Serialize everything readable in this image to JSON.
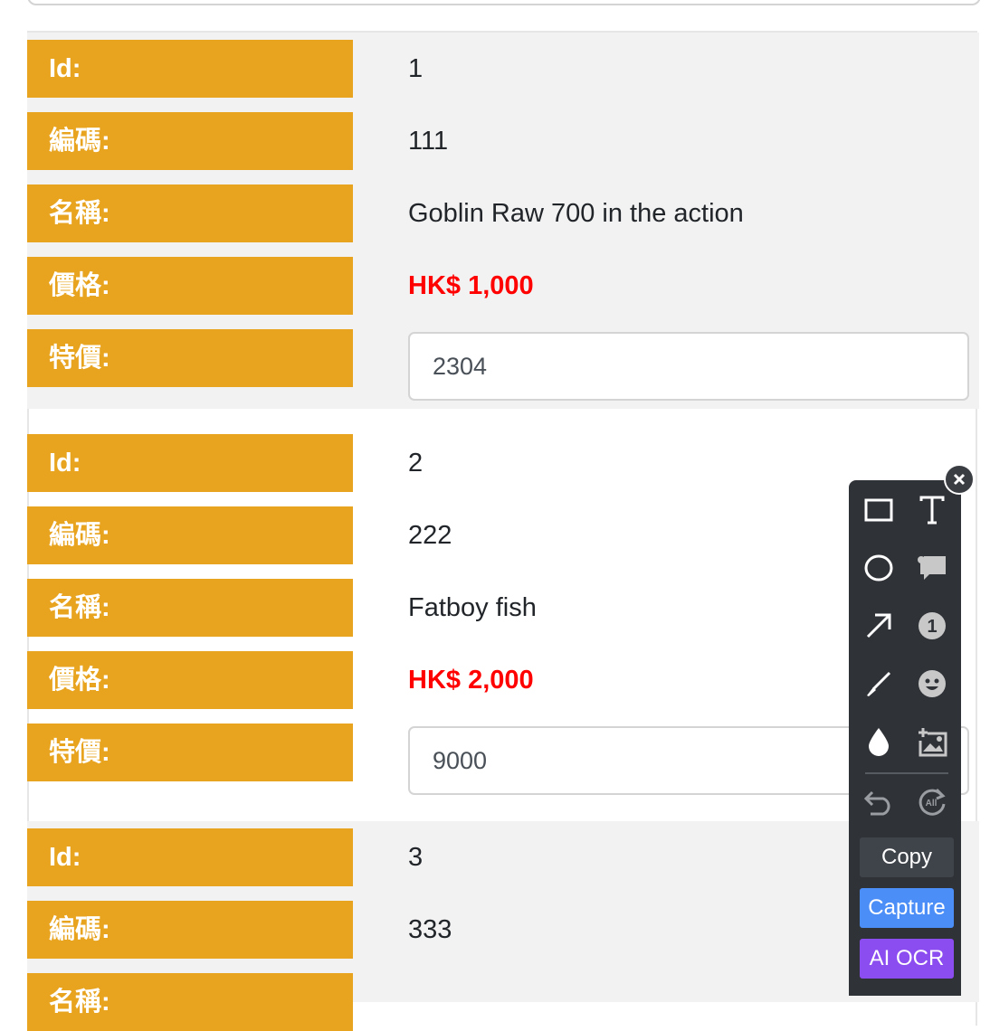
{
  "labels": {
    "id": "Id:",
    "code": "編碼:",
    "name": "名稱:",
    "price": "價格:",
    "special_price": "特價:"
  },
  "records": [
    {
      "id": "1",
      "code": "111",
      "name": "Goblin Raw 700 in the action",
      "price": "HK$ 1,000",
      "special_price": "2304"
    },
    {
      "id": "2",
      "code": "222",
      "name": "Fatboy fish",
      "price": "HK$ 2,000",
      "special_price": "9000"
    },
    {
      "id": "3",
      "code": "333"
    }
  ],
  "toolbar": {
    "tools": [
      "rectangle-icon",
      "text-icon",
      "ellipse-icon",
      "speech-bubble-icon",
      "arrow-icon",
      "number-marker-icon",
      "pen-icon",
      "emoji-icon",
      "blur-drop-icon",
      "add-image-icon",
      "undo-icon",
      "reset-all-icon"
    ],
    "reset_all_badge": "All",
    "number_marker": "1",
    "copy_label": "Copy",
    "capture_label": "Capture",
    "ocr_label": "AI OCR",
    "colors": {
      "background": "#2f3237",
      "copy": "#3f434a",
      "capture": "#4c8ef7",
      "ocr": "#8b4cf0"
    }
  },
  "colors": {
    "label_bg": "#e8a41f",
    "price": "#ff0000",
    "row_shade": "#f2f2f2"
  }
}
